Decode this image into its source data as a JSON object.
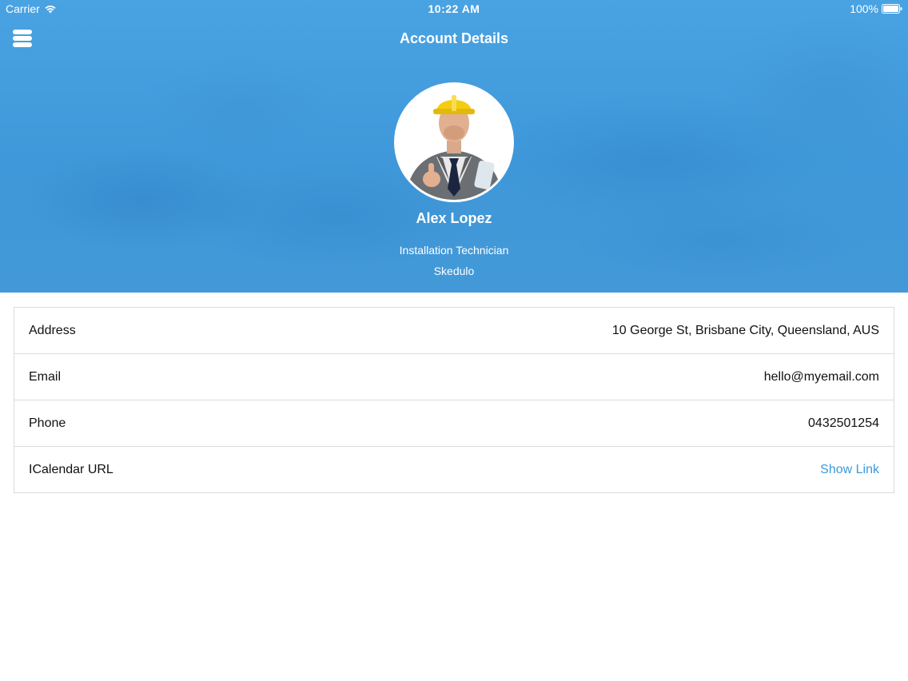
{
  "status_bar": {
    "carrier": "Carrier",
    "time": "10:22 AM",
    "battery": "100%"
  },
  "nav": {
    "title": "Account Details",
    "menu_icon": "menu-icon"
  },
  "profile": {
    "name": "Alex Lopez",
    "role": "Installation Technician",
    "company": "Skedulo"
  },
  "details": [
    {
      "label": "Address",
      "value": "10 George St, Brisbane City, Queensland, AUS"
    },
    {
      "label": "Email",
      "value": "hello@myemail.com"
    },
    {
      "label": "Phone",
      "value": "0432501254"
    },
    {
      "label": "ICalendar URL",
      "value": "Show Link"
    }
  ],
  "colors": {
    "header": "#4aa1e1",
    "link": "#3a9bdc",
    "border": "#dcdcdc"
  }
}
